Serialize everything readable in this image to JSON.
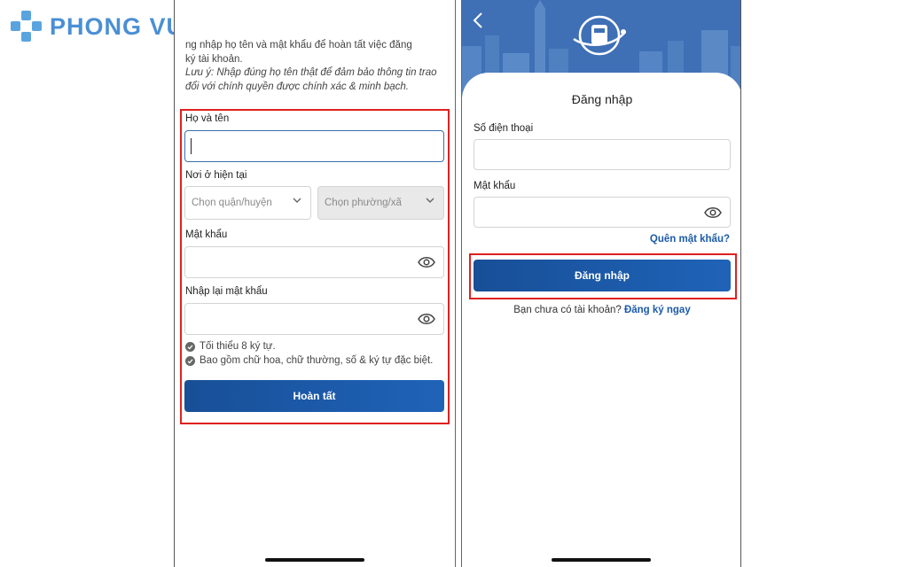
{
  "brand": {
    "name": "PHONG VU",
    "colors": {
      "logo": "#4a8fd4",
      "logo_mark": "#59a4df",
      "primary": "#1c5aa8",
      "highlight": "#e02020"
    }
  },
  "signup": {
    "intro_line1": "ng nhập họ tên và mật khẩu để hoàn tất việc đăng",
    "intro_line2": "ký tài khoản.",
    "note_line1": "Lưu ý: Nhập đúng họ tên thật để đảm bảo thông tin trao",
    "note_line2": "đổi với chính quyền được chính xác & minh bạch.",
    "name_label": "Họ và tên",
    "name_value": "",
    "residence_label": "Nơi ở hiện tại",
    "district_placeholder": "Chọn quận/huyện",
    "ward_placeholder": "Chọn phường/xã",
    "password_label": "Mật khẩu",
    "confirm_password_label": "Nhập lại mật khẩu",
    "requirements": [
      "Tối thiểu 8 ký tự.",
      "Bao gồm chữ hoa, chữ thường, số & ký tự đặc biệt."
    ],
    "submit_label": "Hoàn tất"
  },
  "login": {
    "title": "Đăng nhập",
    "phone_label": "Số điện thoại",
    "password_label": "Mật khẩu",
    "forgot_password": "Quên mật khẩu?",
    "submit_label": "Đăng nhập",
    "no_account_text": "Bạn chưa có tài khoản?",
    "register_link": "Đăng ký ngay"
  },
  "icons": [
    "back-chevron-icon",
    "hanoi-emblem-icon",
    "eye-icon",
    "chevron-down-icon",
    "check-circle-icon"
  ]
}
